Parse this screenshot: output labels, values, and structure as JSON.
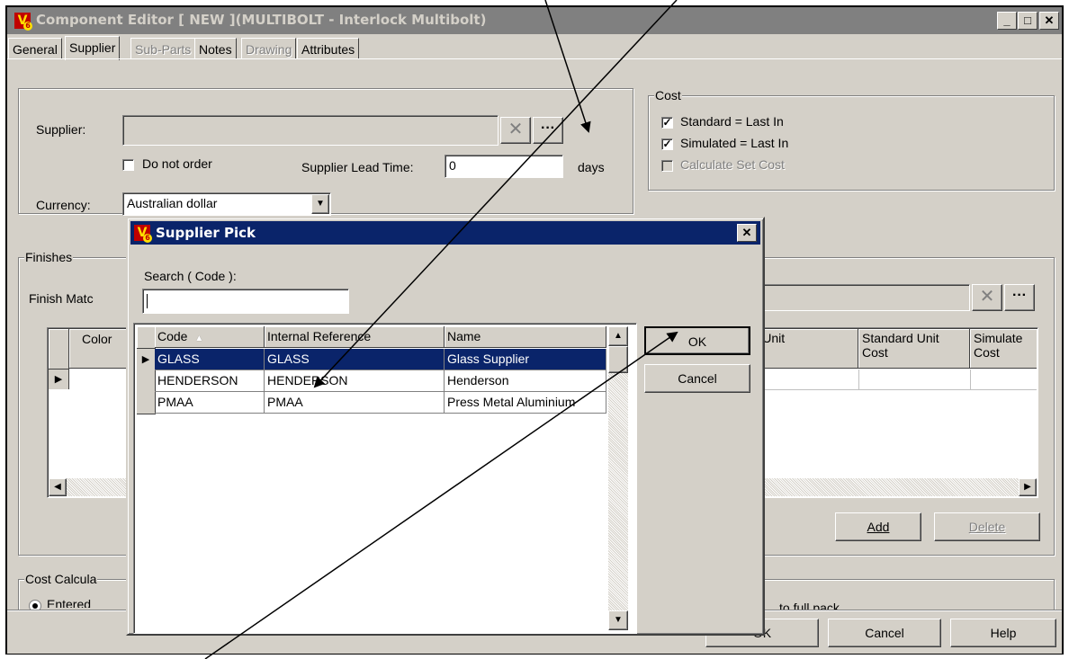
{
  "window": {
    "title": "Component Editor  [ NEW ](MULTIBOLT - Interlock Multibolt)",
    "logo_letter": "V"
  },
  "tabs": [
    {
      "label": "General",
      "enabled": true
    },
    {
      "label": "Supplier",
      "enabled": true,
      "active": true
    },
    {
      "label": "Sub-Parts",
      "enabled": false
    },
    {
      "label": "Notes",
      "enabled": true
    },
    {
      "label": "Drawing",
      "enabled": false
    },
    {
      "label": "Attributes",
      "enabled": true
    }
  ],
  "supplier": {
    "label": "Supplier:",
    "value": "",
    "clear_icon": "x-icon",
    "pick_icon": "ellipsis-icon",
    "do_not_order": "Do not order",
    "do_not_order_checked": false,
    "lead_time_label": "Supplier Lead Time:",
    "lead_time_value": "0",
    "lead_time_units": "days",
    "currency_label": "Currency:",
    "currency_value": "Australian dollar"
  },
  "cost": {
    "legend": "Cost",
    "standard": "Standard = Last In",
    "standard_checked": true,
    "simulated": "Simulated = Last In",
    "simulated_checked": true,
    "calculate_set_cost": "Calculate Set Cost",
    "calculate_set_cost_checked": false
  },
  "finishes": {
    "legend": "Finishes",
    "finish_match_label": "Finish Matc",
    "color_header": "Color",
    "right_headers": [
      "t In  Unit\nst",
      "Standard Unit\nCost",
      "Simulate\nCost"
    ],
    "add_label": "Add",
    "delete_label": "Delete"
  },
  "cost_calc": {
    "legend": "Cost Calcula",
    "entered": "Entered",
    "right_text": "to full pack"
  },
  "footer": {
    "ok_label": "OK",
    "cancel_label": "Cancel",
    "help_label": "Help"
  },
  "dialog": {
    "title": "Supplier Pick",
    "search_label": "Search ( Code ):",
    "search_value": "",
    "columns": [
      "Code",
      "Internal Reference",
      "Name"
    ],
    "sort_indicator": "▲",
    "rows": [
      {
        "code": "GLASS",
        "ref": "GLASS",
        "name": "Glass Supplier",
        "selected": true
      },
      {
        "code": "HENDERSON",
        "ref": "HENDERSON",
        "name": "Henderson",
        "selected": false
      },
      {
        "code": "PMAA",
        "ref": "PMAA",
        "name": "Press Metal Aluminium",
        "selected": false
      }
    ],
    "ok_label": "OK",
    "cancel_label": "Cancel"
  },
  "colors": {
    "title_active": "#0a246a",
    "title_inactive": "#808080",
    "face": "#d4d0c8",
    "logo_red": "#c00000",
    "logo_yellow": "#ffdf00"
  }
}
